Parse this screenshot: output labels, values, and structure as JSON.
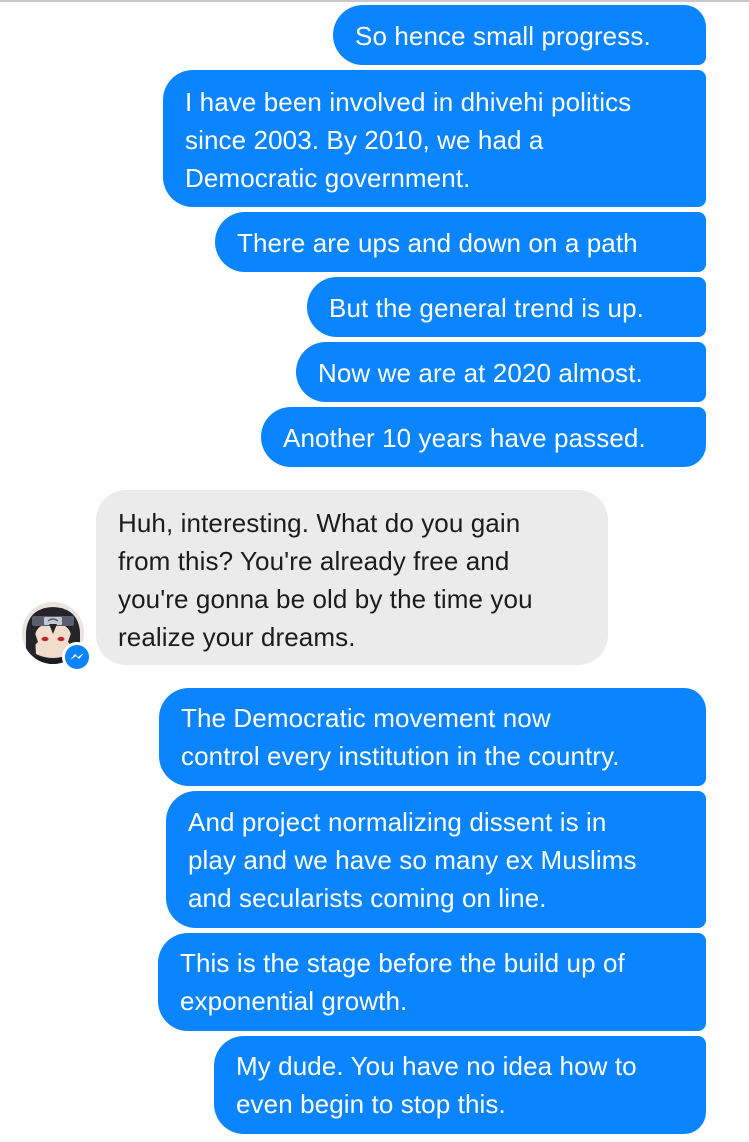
{
  "messages": [
    {
      "side": "sent",
      "text": "So hence small progress."
    },
    {
      "side": "sent",
      "text": "I have been involved in dhivehi politics\nsince 2003. By 2010, we had a\nDemocratic government."
    },
    {
      "side": "sent",
      "text": "There are ups and down on a path"
    },
    {
      "side": "sent",
      "text": "But the general trend is up."
    },
    {
      "side": "sent",
      "text": "Now we are at 2020 almost."
    },
    {
      "side": "sent",
      "text": "Another 10 years have passed."
    },
    {
      "side": "received",
      "text": "Huh, interesting. What do you gain\nfrom this? You're already free and\nyou're gonna be old by the time you\nrealize your dreams."
    },
    {
      "side": "sent",
      "text": "The Democratic movement now\ncontrol every institution in the country."
    },
    {
      "side": "sent",
      "text": "And project normalizing dissent is in\nplay and we have so many ex Muslims\nand secularists coming on line."
    },
    {
      "side": "sent",
      "text": "This is the stage before the build up of\nexponential growth."
    },
    {
      "side": "sent",
      "text": "My dude. You have no idea how to\neven begin to stop this."
    }
  ],
  "contact": {
    "avatar_icon": "anime-character-avatar-icon",
    "badge_icon": "messenger-bolt-icon"
  },
  "colors": {
    "sent_bubble": "#0a84ff",
    "received_bubble": "#ebebeb",
    "sent_text": "#ffffff",
    "received_text": "#1c1c1e"
  }
}
